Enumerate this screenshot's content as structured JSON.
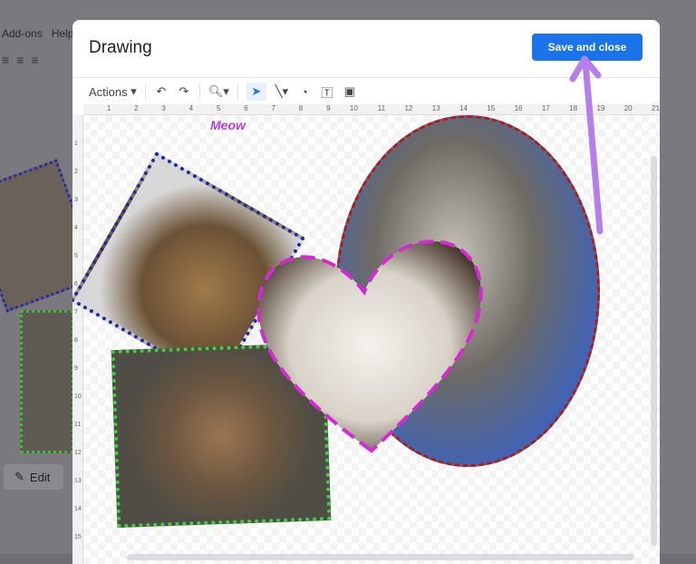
{
  "background": {
    "menu": [
      "Add-ons",
      "Help"
    ],
    "edit_label": "Edit"
  },
  "dialog": {
    "title": "Drawing",
    "save_label": "Save and close"
  },
  "toolbar": {
    "actions_label": "Actions",
    "icons": [
      "undo-icon",
      "redo-icon",
      "zoom-icon",
      "select-icon",
      "line-icon",
      "shape-icon",
      "textbox-icon",
      "image-icon"
    ]
  },
  "ruler": {
    "h": [
      "1",
      "2",
      "3",
      "4",
      "5",
      "6",
      "7",
      "8",
      "9",
      "10",
      "11",
      "12",
      "13",
      "14",
      "15",
      "16",
      "17",
      "18",
      "19",
      "20",
      "21"
    ],
    "v": [
      "1",
      "2",
      "3",
      "4",
      "5",
      "6",
      "7",
      "8",
      "9",
      "10",
      "11",
      "12",
      "13",
      "14",
      "15"
    ]
  },
  "canvas": {
    "text_box": "Meow"
  },
  "colors": {
    "accent": "#1a73e8",
    "annotation_arrow": "#b57ee8"
  }
}
